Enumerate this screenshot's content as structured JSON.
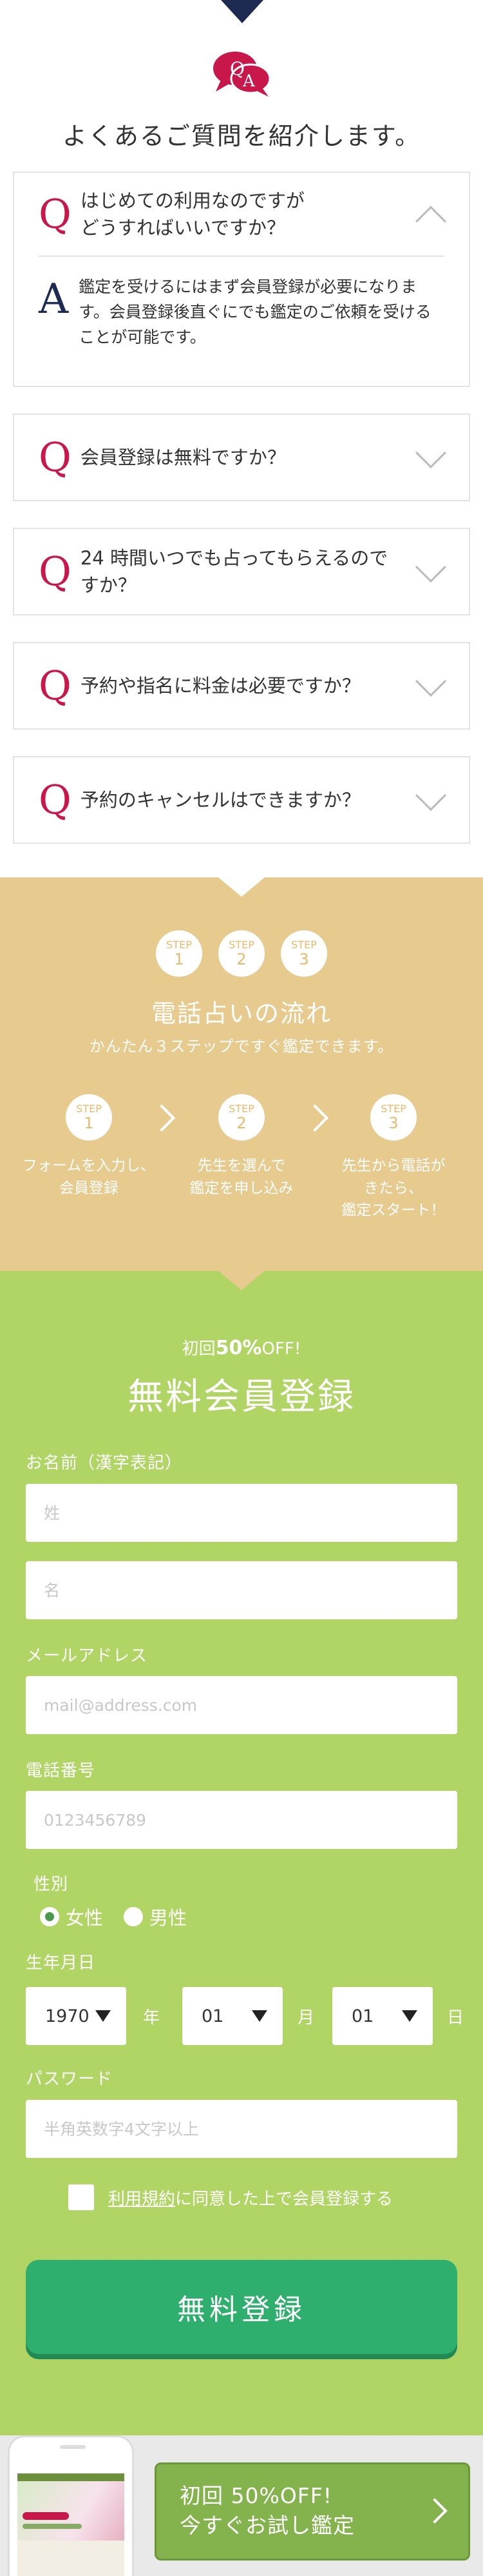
{
  "faq": {
    "heading": "よくあるご質問を紹介します。",
    "q_mark": "Q",
    "a_mark": "A",
    "items": [
      {
        "question": "はじめての利用なのですが\nどうすればいいですか？",
        "answer": "鑑定を受けるにはまず会員登録が必要になります。会員登録後直ぐにでも鑑定のご依頼を受けることが可能です。",
        "expanded": true
      },
      {
        "question": "会員登録は無料ですか？",
        "expanded": false
      },
      {
        "question": "24 時間いつでも占ってもらえるのですか？",
        "expanded": false
      },
      {
        "question": "予約や指名に料金は必要ですか？",
        "expanded": false
      },
      {
        "question": "予約のキャンセルはできますか？",
        "expanded": false
      }
    ]
  },
  "steps": {
    "badge_label": "STEP",
    "badges": [
      "1",
      "2",
      "3"
    ],
    "title": "電話占いの流れ",
    "subtitle": "かんたん３ステップですぐ鑑定できます。",
    "items": [
      {
        "label": "STEP",
        "num": "1",
        "desc": "フォームを入力し、\n会員登録"
      },
      {
        "label": "STEP",
        "num": "2",
        "desc": "先生を選んで\n鑑定を申し込み"
      },
      {
        "label": "STEP",
        "num": "3",
        "desc": "先生から電話が\nきたら、\n鑑定スタート！"
      }
    ]
  },
  "register": {
    "promo_prefix": "初回",
    "promo_value": "50%",
    "promo_suffix": "OFF!",
    "title": "無料会員登録",
    "name_label": "お名前（漢字表記）",
    "last_name_placeholder": "姓",
    "first_name_placeholder": "名",
    "email_label": "メールアドレス",
    "email_placeholder": "mail@address.com",
    "phone_label": "電話番号",
    "phone_placeholder": "0123456789",
    "gender_label": "性別",
    "gender_options": [
      "女性",
      "男性"
    ],
    "gender_selected": "女性",
    "birthday_label": "生年月日",
    "year_value": "1970",
    "year_unit": "年",
    "month_value": "01",
    "month_unit": "月",
    "day_value": "01",
    "day_unit": "日",
    "password_label": "パスワード",
    "password_placeholder": "半角英数字4文字以上",
    "terms_link": "利用規約",
    "terms_text": "に同意した上で会員登録する",
    "submit_label": "無料登録"
  },
  "bottom_bar": {
    "cta_line1": "初回 50%OFF!",
    "cta_line2": "今すぐお試し鑑定"
  },
  "colors": {
    "q_red": "#c8174b",
    "navy": "#1d2a52",
    "steps_bg": "#e6ca8e",
    "register_bg": "#b1d564",
    "submit_green": "#2eaf6d",
    "cta_green": "#84b34d"
  }
}
